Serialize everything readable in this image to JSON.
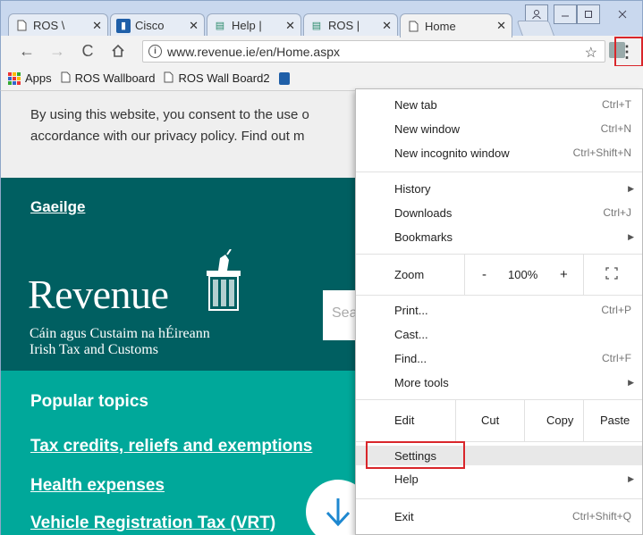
{
  "window": {
    "controls": [
      "&",
      "—",
      "□",
      "✕"
    ]
  },
  "tabs": [
    {
      "title": "ROS \\",
      "icon": "page-icon"
    },
    {
      "title": "Cisco",
      "icon": "cisco-icon"
    },
    {
      "title": "Help |",
      "icon": "ros-icon"
    },
    {
      "title": "ROS |",
      "icon": "ros-icon"
    },
    {
      "title": "Home",
      "icon": "page-icon"
    }
  ],
  "address_bar": {
    "url": "www.revenue.ie/en/Home.aspx"
  },
  "bookmarks": [
    {
      "label": "Apps",
      "icon": "apps-icon"
    },
    {
      "label": "ROS Wallboard",
      "icon": "page-icon"
    },
    {
      "label": "ROS Wall Board2",
      "icon": "page-icon"
    }
  ],
  "page": {
    "cookie_line1": "By using this website, you consent to the use o",
    "cookie_line2": "accordance with our privacy policy. Find out m",
    "language_link": "Gaeilge",
    "logo_word": "Revenue",
    "logo_sub1": "Cáin agus Custaim na hÉireann",
    "logo_sub2": "Irish Tax and Customs",
    "search_placeholder": "Sea",
    "popular_title": "Popular topics",
    "topics": [
      "Tax credits, reliefs and exemptions",
      "Health expenses",
      "Vehicle Registration Tax (VRT)"
    ]
  },
  "menu": {
    "new_tab": {
      "label": "New tab",
      "shortcut": "Ctrl+T"
    },
    "new_window": {
      "label": "New window",
      "shortcut": "Ctrl+N"
    },
    "new_incognito": {
      "label": "New incognito window",
      "shortcut": "Ctrl+Shift+N"
    },
    "history": {
      "label": "History"
    },
    "downloads": {
      "label": "Downloads",
      "shortcut": "Ctrl+J"
    },
    "bookmarks": {
      "label": "Bookmarks"
    },
    "zoom": {
      "label": "Zoom",
      "minus": "-",
      "value": "100%",
      "plus": "+"
    },
    "print": {
      "label": "Print...",
      "shortcut": "Ctrl+P"
    },
    "cast": {
      "label": "Cast..."
    },
    "find": {
      "label": "Find...",
      "shortcut": "Ctrl+F"
    },
    "more_tools": {
      "label": "More tools"
    },
    "edit": {
      "label": "Edit",
      "cut": "Cut",
      "copy": "Copy",
      "paste": "Paste"
    },
    "settings": {
      "label": "Settings"
    },
    "help": {
      "label": "Help"
    },
    "exit": {
      "label": "Exit",
      "shortcut": "Ctrl+Shift+Q"
    }
  },
  "colors": {
    "dark_teal": "#005f61",
    "teal": "#00a89a",
    "highlight_red": "#d9262b"
  }
}
